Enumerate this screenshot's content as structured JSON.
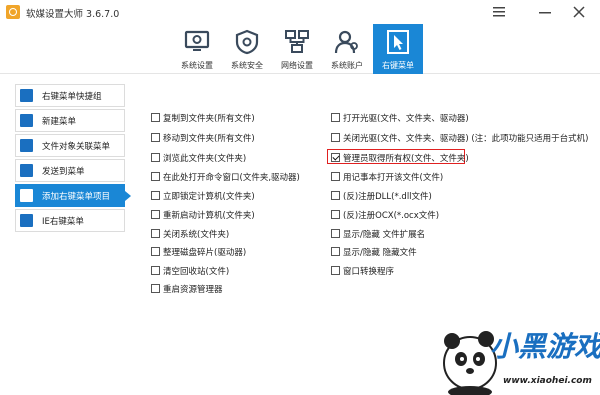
{
  "app": {
    "title": "软媒设置大师 3.6.7.0"
  },
  "toolbar": {
    "tabs": [
      {
        "label": "系统设置",
        "icon": "monitor-gear-icon"
      },
      {
        "label": "系统安全",
        "icon": "shield-gear-icon"
      },
      {
        "label": "网络设置",
        "icon": "network-icon"
      },
      {
        "label": "系统账户",
        "icon": "users-icon"
      },
      {
        "label": "右键菜单",
        "icon": "cursor-icon",
        "active": true
      }
    ]
  },
  "sidebar": {
    "items": [
      {
        "label": "右键菜单快捷组"
      },
      {
        "label": "新建菜单"
      },
      {
        "label": "文件对象关联菜单"
      },
      {
        "label": "发送到菜单"
      },
      {
        "label": "添加右键菜单项目",
        "active": true
      },
      {
        "label": "IE右键菜单"
      }
    ]
  },
  "options": {
    "left": [
      {
        "label": "复制到文件夹(所有文件)",
        "checked": false
      },
      {
        "label": "移动到文件夹(所有文件)",
        "checked": false
      },
      {
        "label": "浏览此文件夹(文件夹)",
        "checked": false
      },
      {
        "label": "在此处打开命令窗口(文件夹,驱动器)",
        "checked": false
      },
      {
        "label": "立即锁定计算机(文件夹)",
        "checked": false
      },
      {
        "label": "重新启动计算机(文件夹)",
        "checked": false
      },
      {
        "label": "关闭系统(文件夹)",
        "checked": false
      },
      {
        "label": "整理磁盘碎片(驱动器)",
        "checked": false
      },
      {
        "label": "清空回收站(文件)",
        "checked": false
      },
      {
        "label": "重启资源管理器",
        "checked": false
      }
    ],
    "right": [
      {
        "label": "打开光驱(文件、文件夹、驱动器)",
        "checked": false
      },
      {
        "label": "关闭光驱(文件、文件夹、驱动器) (注：此项功能只适用于台式机)",
        "checked": false
      },
      {
        "label": "管理员取得所有权(文件、文件夹)",
        "checked": true
      },
      {
        "label": "用记事本打开该文件(文件)",
        "checked": false
      },
      {
        "label": "(反)注册DLL(*.dll文件)",
        "checked": false
      },
      {
        "label": "(反)注册OCX(*.ocx文件)",
        "checked": false
      },
      {
        "label": "显示/隐藏 文件扩展名",
        "checked": false
      },
      {
        "label": "显示/隐藏 隐藏文件",
        "checked": false
      },
      {
        "label": "窗口转换程序",
        "checked": false
      }
    ]
  },
  "watermark": {
    "brand": "小黑游戏",
    "url": "www.xiaohei.com"
  },
  "colors": {
    "accent": "#1a87d6",
    "highlight": "#e02020"
  }
}
